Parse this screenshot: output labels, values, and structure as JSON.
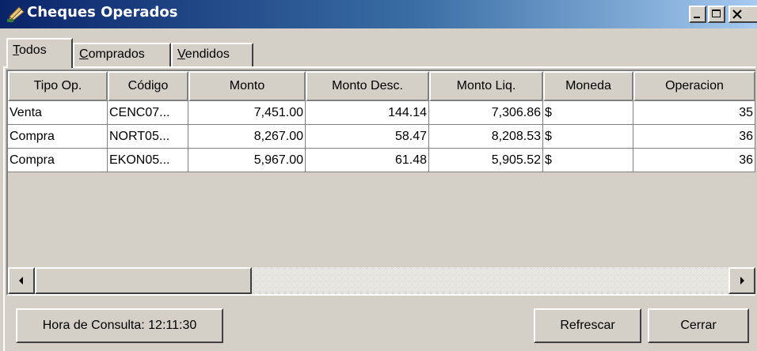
{
  "window": {
    "title": "Cheques Operados",
    "icon": "cheques-app-icon",
    "controls": [
      "minimize",
      "maximize",
      "close"
    ]
  },
  "tabs": [
    {
      "mnemonic": "T",
      "rest": "odos",
      "active": true
    },
    {
      "mnemonic": "C",
      "rest": "omprados",
      "active": false
    },
    {
      "mnemonic": "V",
      "rest": "endidos",
      "active": false
    }
  ],
  "table": {
    "columns": [
      "Tipo Op.",
      "Código",
      "Monto",
      "Monto Desc.",
      "Monto Liq.",
      "Moneda",
      "Operacion"
    ],
    "rows": [
      [
        "Venta",
        "CENC07...",
        "7,451.00",
        "144.14",
        "7,306.86",
        "$",
        "35"
      ],
      [
        "Compra",
        "NORT05...",
        "8,267.00",
        "58.47",
        "8,208.53",
        "$",
        "36"
      ],
      [
        "Compra",
        "EKON05...",
        "5,967.00",
        "61.48",
        "5,905.52",
        "$",
        "36"
      ]
    ]
  },
  "footer": {
    "hora_label": "Hora de Consulta: 12:11:30",
    "refresh_label": "Refrescar",
    "close_label": "Cerrar"
  },
  "colors": {
    "titlebar_start": "#0a246a",
    "titlebar_end": "#a6caf0",
    "face": "#d4d0c8"
  }
}
